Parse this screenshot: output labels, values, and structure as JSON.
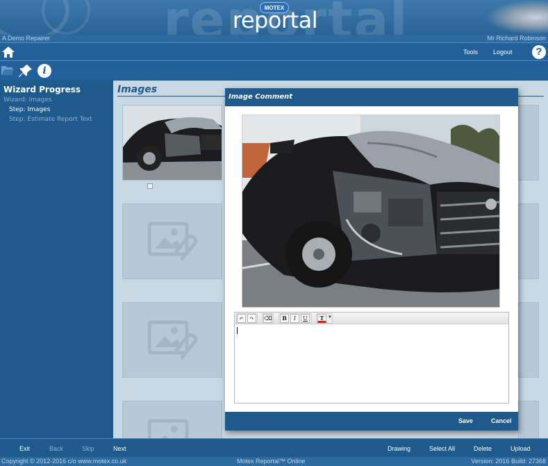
{
  "header": {
    "brand_badge": "MOTEX",
    "brand_name": "reportal",
    "watermark": "reportal",
    "company": "A Demo Repairer",
    "user": "Mr Richard Robinson"
  },
  "nav": {
    "tools_label": "Tools",
    "logout_label": "Logout",
    "help_glyph": "?",
    "home_icon": "home-icon"
  },
  "toolbar": {
    "icons": [
      "folder-open-icon",
      "pin-icon",
      "info-icon"
    ],
    "info_glyph": "i"
  },
  "sidebar": {
    "title": "Wizard Progress",
    "wizard_line": "Wizard: Images",
    "steps": [
      {
        "label": "Step: Images",
        "active": true
      },
      {
        "label": "Step: Estimate Report Text",
        "active": false
      }
    ]
  },
  "main": {
    "heading": "Images"
  },
  "modal": {
    "title": "Image Comment",
    "save_label": "Save",
    "cancel_label": "Cancel",
    "editor": {
      "buttons": [
        {
          "name": "undo-button",
          "glyph": "↶"
        },
        {
          "name": "redo-button",
          "glyph": "↷"
        },
        {
          "name": "eraser-button",
          "glyph": "⌫"
        },
        {
          "name": "bold-button",
          "glyph": "B"
        },
        {
          "name": "italic-button",
          "glyph": "I"
        },
        {
          "name": "underline-button",
          "glyph": "U"
        },
        {
          "name": "text-color-button",
          "glyph": "T"
        }
      ],
      "text_color": "#e02020",
      "content": ""
    }
  },
  "actions": {
    "exit": "Exit",
    "back": "Back",
    "skip": "Skip",
    "next": "Next",
    "drawing": "Drawing",
    "select_all": "Select All",
    "delete": "Delete",
    "upload": "Upload"
  },
  "status": {
    "copyright": "Copyright © 2012-2016 c/o www.motex.co.uk",
    "product": "Motex Reportal™ Online",
    "version": "Version: 2016 Build: 27368"
  },
  "colors": {
    "brand_blue": "#1f5a8c",
    "panel": "#c8d7e4"
  }
}
